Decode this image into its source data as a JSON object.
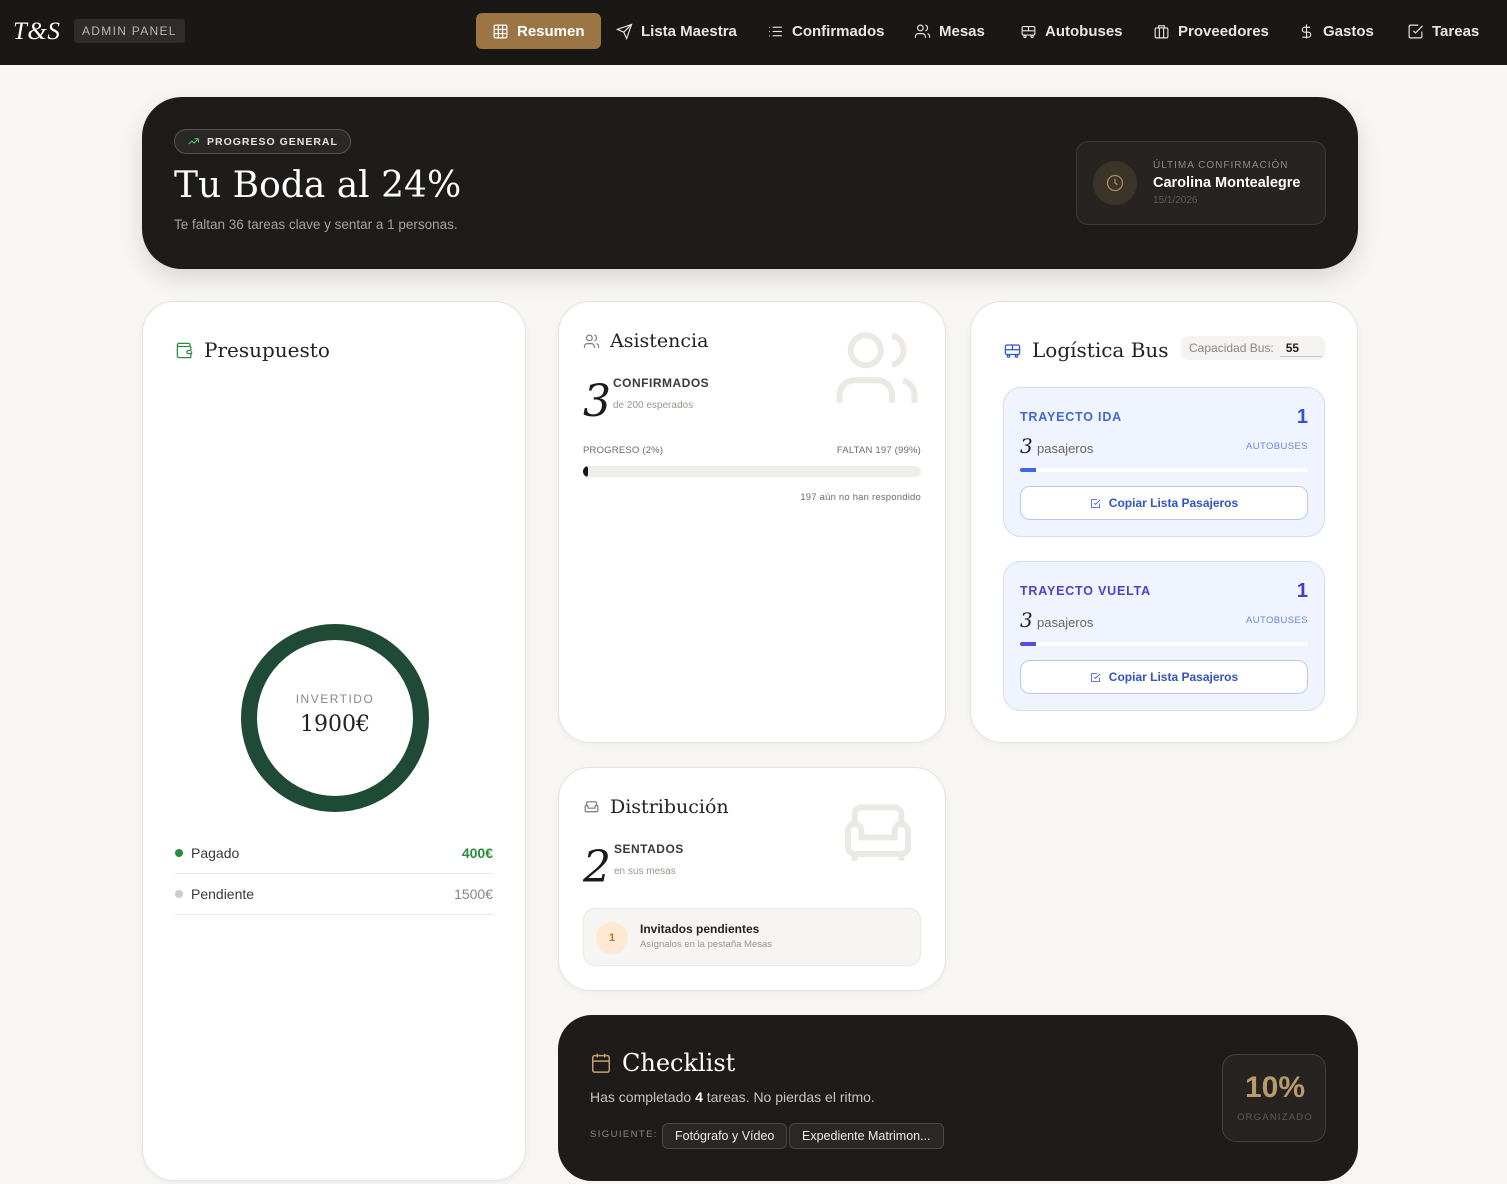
{
  "brand": {
    "logo": "T&S",
    "badge": "ADMIN PANEL"
  },
  "nav": [
    {
      "label": "Resumen",
      "icon": "grid-icon",
      "active": true
    },
    {
      "label": "Lista Maestra",
      "icon": "send-icon"
    },
    {
      "label": "Confirmados",
      "icon": "list-icon"
    },
    {
      "label": "Mesas",
      "icon": "users-icon"
    },
    {
      "label": "Autobuses",
      "icon": "bus-icon"
    },
    {
      "label": "Proveedores",
      "icon": "briefcase-icon"
    },
    {
      "label": "Gastos",
      "icon": "dollar-icon"
    },
    {
      "label": "Tareas",
      "icon": "checkbox-icon"
    }
  ],
  "hero": {
    "pill": "PROGRESO GENERAL",
    "title": "Tu Boda al 24%",
    "subtitle": "Te faltan 36 tareas clave y sentar a 1 personas.",
    "last": {
      "label": "ÚLTIMA CONFIRMACIÓN",
      "name": "Carolina Montealegre",
      "date": "15/1/2026"
    }
  },
  "budget": {
    "title": "Presupuesto",
    "donut_label": "INVERTIDO",
    "donut_value": "1900€",
    "paid_fraction": 1.0,
    "rows": [
      {
        "label": "Pagado",
        "value": "400€",
        "color": "#2d8a3c"
      },
      {
        "label": "Pendiente",
        "value": "1500€",
        "color": "#cfcbc6"
      }
    ],
    "donut_color": "#1f4a36"
  },
  "attendance": {
    "title": "Asistencia",
    "count": "3",
    "head": "CONFIRMADOS",
    "sub": "de 200 esperados",
    "progress_label": "PROGRESO (2%)",
    "remaining_label": "FALTAN 197 (99%)",
    "progress_fraction": 0.015,
    "note": "197 aún no han respondido"
  },
  "bus": {
    "title": "Logística Bus",
    "capacity_label": "Capacidad Bus:",
    "capacity_value": "55",
    "trips": [
      {
        "title": "TRAYECTO IDA",
        "buses": "1",
        "buses_label": "AUTOBUSES",
        "passengers": "3",
        "passengers_label": "pasajeros",
        "fill": 0.055,
        "color": "#3d68e0",
        "button": "Copiar Lista Pasajeros"
      },
      {
        "title": "TRAYECTO VUELTA",
        "buses": "1",
        "buses_label": "AUTOBUSES",
        "passengers": "3",
        "passengers_label": "pasajeros",
        "fill": 0.055,
        "color": "#5a4bd8",
        "button": "Copiar Lista Pasajeros"
      }
    ]
  },
  "distribution": {
    "title": "Distribución",
    "count": "2",
    "head": "SENTADOS",
    "sub": "en sus mesas",
    "pending_count": "1",
    "pending_title": "Invitados pendientes",
    "pending_sub": "Asígnalos en la pestaña Mesas"
  },
  "checklist": {
    "title": "Checklist",
    "sub_before": "Has completado ",
    "sub_count": "4",
    "sub_after": " tareas. No pierdas el ritmo.",
    "next_label": "SIGUIENTE:",
    "next": [
      "Fotógrafo y Vídeo",
      "Expediente Matrimon..."
    ],
    "percent": "10%",
    "percent_label": "ORGANIZADO"
  }
}
